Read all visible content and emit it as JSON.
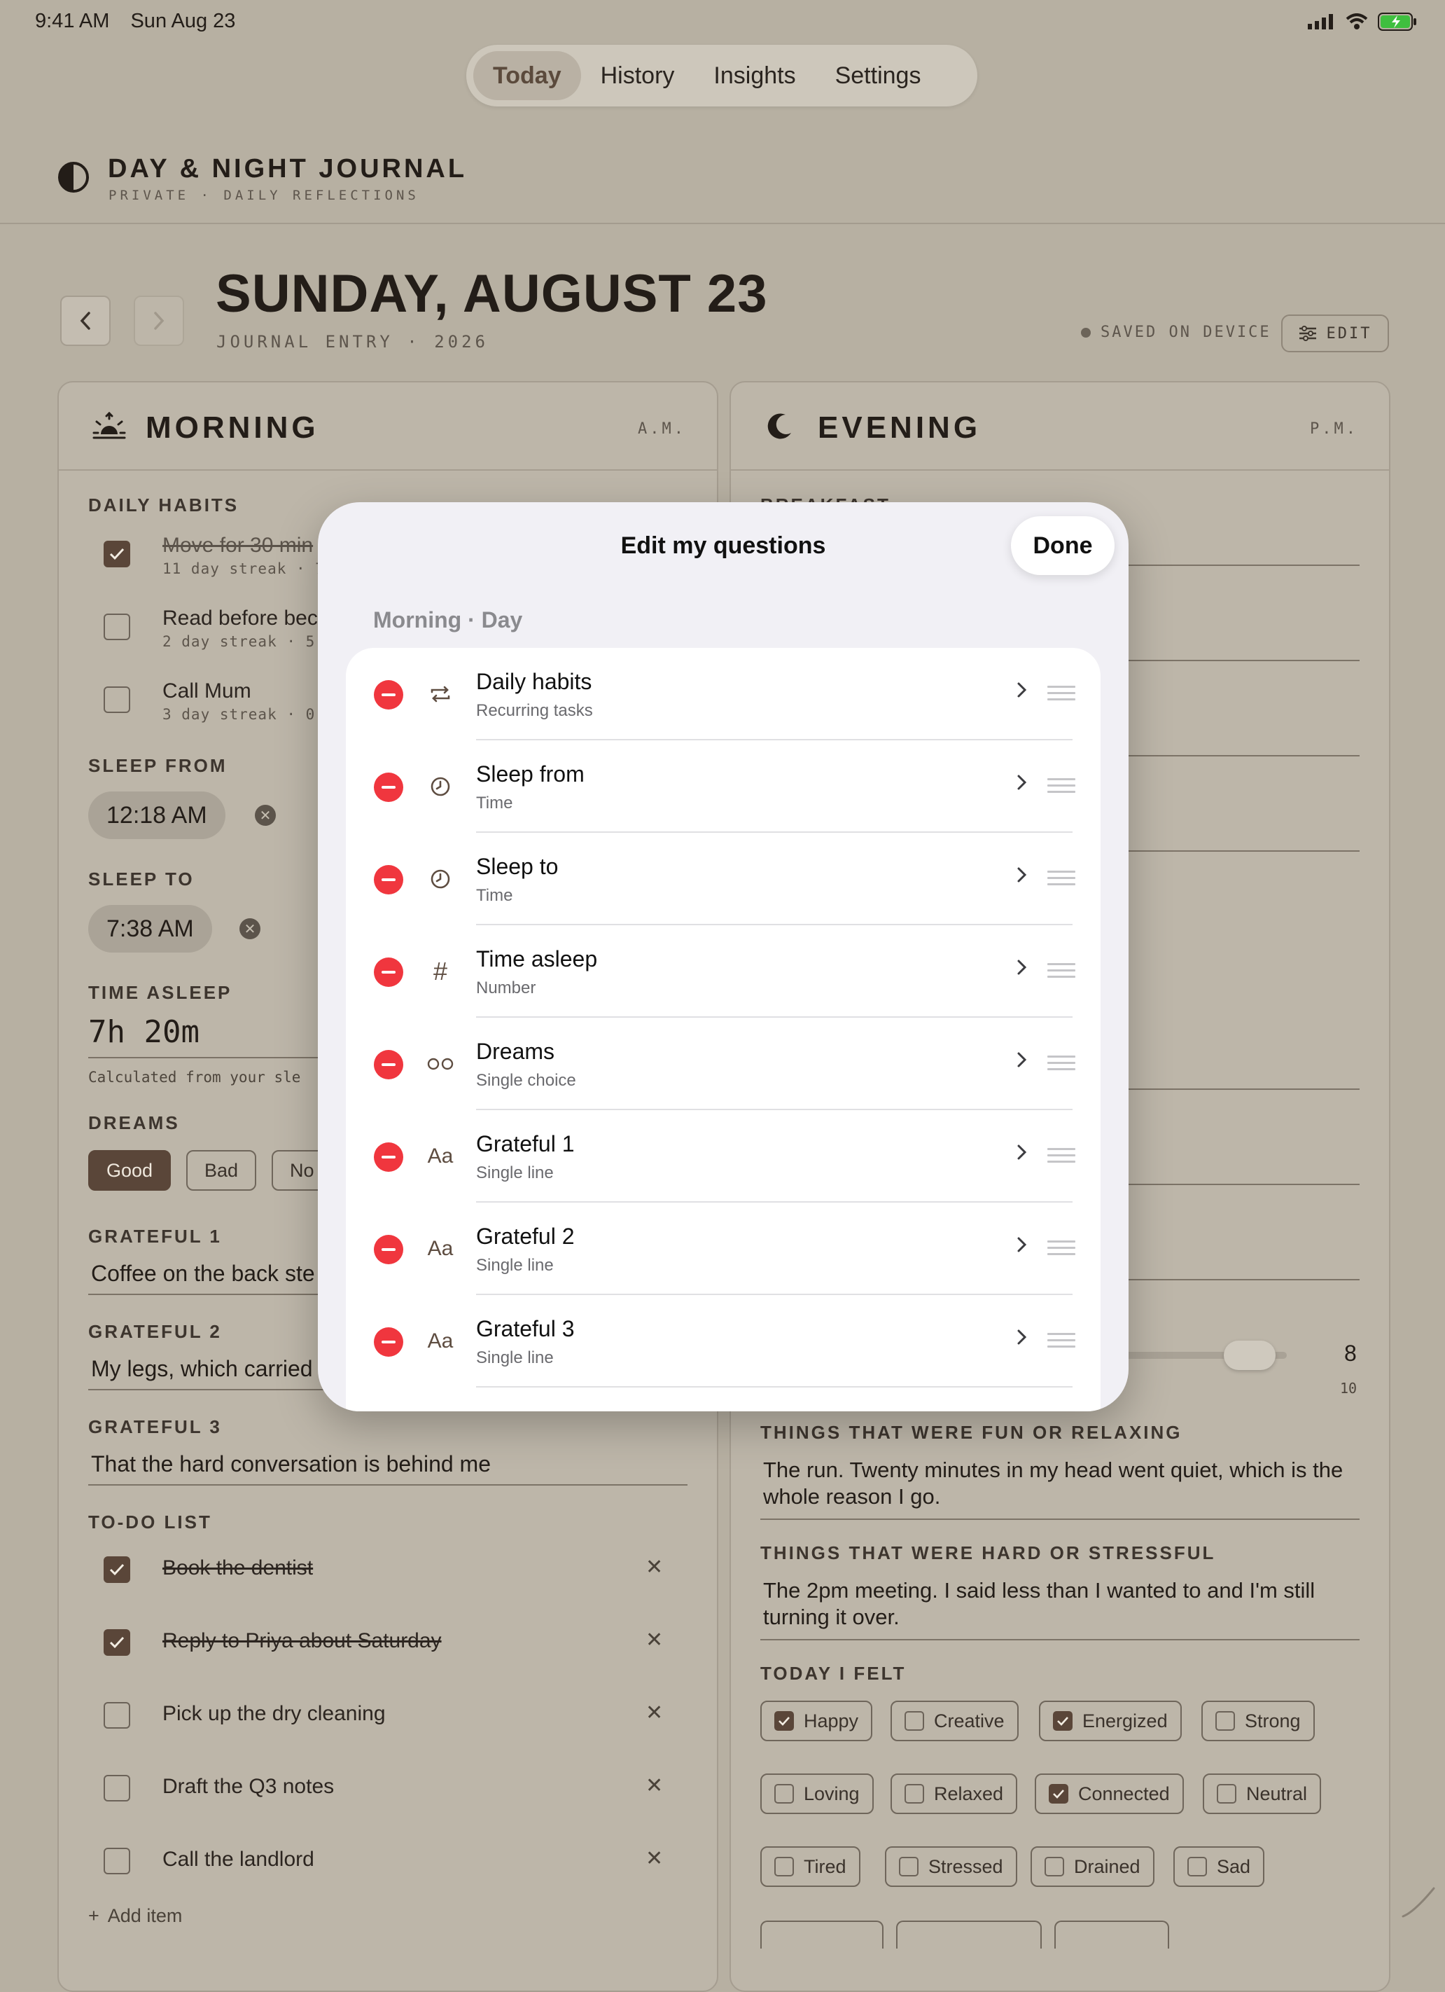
{
  "status": {
    "time": "9:41 AM",
    "date": "Sun Aug 23"
  },
  "tabs": [
    {
      "label": "Today",
      "active": true
    },
    {
      "label": "History",
      "active": false
    },
    {
      "label": "Insights",
      "active": false
    },
    {
      "label": "Settings",
      "active": false
    }
  ],
  "brand": {
    "title": "DAY & NIGHT JOURNAL",
    "subtitle": "PRIVATE · DAILY REFLECTIONS"
  },
  "entry": {
    "title": "SUNDAY, AUGUST 23",
    "subtitle": "JOURNAL ENTRY · 2026",
    "saved": "SAVED ON DEVICE",
    "edit": "EDIT"
  },
  "morning": {
    "title": "MORNING",
    "ampm": "A.M.",
    "habits_label": "DAILY HABITS",
    "habits": [
      {
        "title": "Move for 30 min",
        "sub": "11 day streak · 7",
        "done": true
      },
      {
        "title": "Read before bec",
        "sub": "2 day streak · 5 o",
        "done": false
      },
      {
        "title": "Call Mum",
        "sub": "3 day streak · 0 o",
        "done": false
      }
    ],
    "sleep_from_label": "SLEEP FROM",
    "sleep_from": "12:18 AM",
    "sleep_to_label": "SLEEP TO",
    "sleep_to": "7:38 AM",
    "time_asleep_label": "TIME ASLEEP",
    "time_asleep": "7h 20m",
    "time_asleep_note": "Calculated from your sle",
    "dreams_label": "DREAMS",
    "dreams": [
      {
        "label": "Good",
        "on": true
      },
      {
        "label": "Bad",
        "on": false
      },
      {
        "label": "No",
        "on": false
      }
    ],
    "grateful1_label": "GRATEFUL 1",
    "grateful1": "Coffee on the back ste",
    "grateful2_label": "GRATEFUL 2",
    "grateful2": "My legs, which carried",
    "grateful3_label": "GRATEFUL 3",
    "grateful3": "That the hard conversation is behind me",
    "todo_label": "TO-DO LIST",
    "todos": [
      {
        "text": "Book the dentist",
        "done": true
      },
      {
        "text": "Reply to Priya about Saturday",
        "done": true
      },
      {
        "text": "Pick up the dry cleaning",
        "done": false
      },
      {
        "text": "Draft the Q3 notes",
        "done": false
      },
      {
        "text": "Call the landlord",
        "done": false
      }
    ],
    "add_item": "Add item"
  },
  "evening": {
    "title": "EVENING",
    "ampm": "P.M.",
    "first_label": "BREAKFAST",
    "slider_value": "8",
    "slider_max": "10",
    "slider_fraction": 0.8,
    "fun_label": "THINGS THAT WERE FUN OR RELAXING",
    "fun_text": "The run. Twenty minutes in my head went quiet, which is the whole reason I go.",
    "hard_label": "THINGS THAT WERE HARD OR STRESSFUL",
    "hard_text": "The 2pm meeting. I said less than I wanted to and I'm still turning it over.",
    "felt_label": "TODAY I FELT",
    "moods": [
      [
        {
          "label": "Happy",
          "on": true
        },
        {
          "label": "Creative",
          "on": false
        },
        {
          "label": "Energized",
          "on": true
        },
        {
          "label": "Strong",
          "on": false
        }
      ],
      [
        {
          "label": "Loving",
          "on": false
        },
        {
          "label": "Relaxed",
          "on": false
        },
        {
          "label": "Connected",
          "on": true
        },
        {
          "label": "Neutral",
          "on": false
        }
      ],
      [
        {
          "label": "Tired",
          "on": false
        },
        {
          "label": "Stressed",
          "on": false
        },
        {
          "label": "Drained",
          "on": false
        },
        {
          "label": "Sad",
          "on": false
        }
      ]
    ]
  },
  "modal": {
    "title": "Edit my questions",
    "done": "Done",
    "section": "Morning · Day",
    "questions": [
      {
        "title": "Daily habits",
        "type": "Recurring tasks",
        "icon": "repeat-icon"
      },
      {
        "title": "Sleep from",
        "type": "Time",
        "icon": "clock-icon"
      },
      {
        "title": "Sleep to",
        "type": "Time",
        "icon": "clock-icon"
      },
      {
        "title": "Time asleep",
        "type": "Number",
        "icon": "hash-icon"
      },
      {
        "title": "Dreams",
        "type": "Single choice",
        "icon": "choice-icon"
      },
      {
        "title": "Grateful 1",
        "type": "Single line",
        "icon": "text-icon"
      },
      {
        "title": "Grateful 2",
        "type": "Single line",
        "icon": "text-icon"
      },
      {
        "title": "Grateful 3",
        "type": "Single line",
        "icon": "text-icon"
      }
    ]
  }
}
